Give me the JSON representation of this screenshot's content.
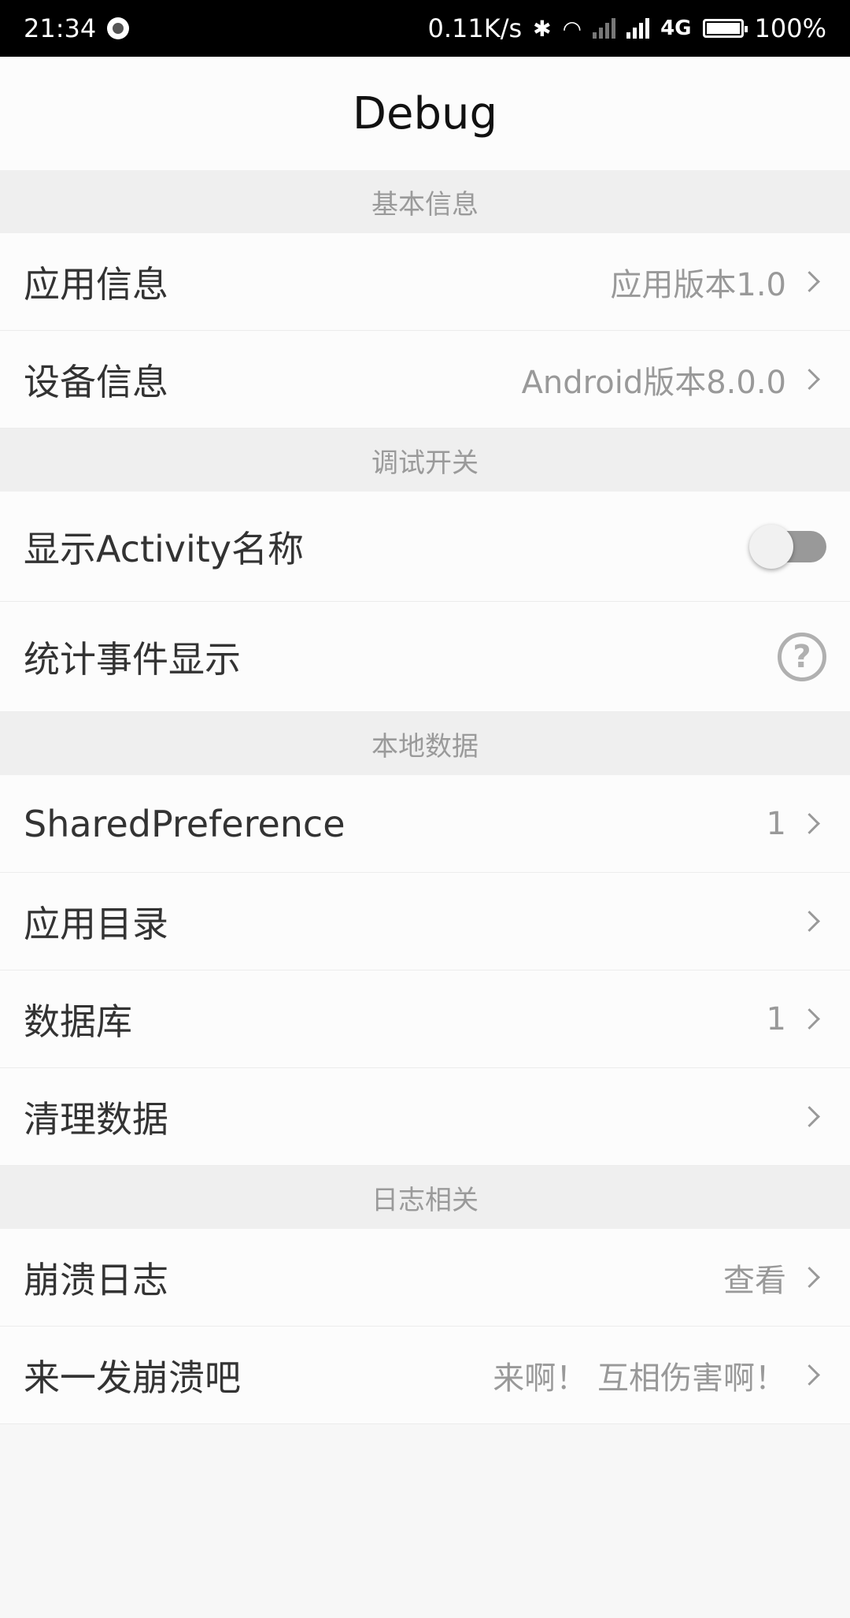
{
  "status": {
    "time": "21:34",
    "speed": "0.11K/s",
    "network": "4G",
    "battery": "100%"
  },
  "title": "Debug",
  "sections": [
    {
      "header": "基本信息",
      "items": [
        {
          "label": "应用信息",
          "value": "应用版本1.0"
        },
        {
          "label": "设备信息",
          "value": "Android版本8.0.0"
        }
      ]
    },
    {
      "header": "调试开关",
      "items": [
        {
          "label": "显示Activity名称",
          "toggle": "off"
        },
        {
          "label": "统计事件显示",
          "icon": "help-icon"
        }
      ]
    },
    {
      "header": "本地数据",
      "items": [
        {
          "label": "SharedPreference",
          "value": "1"
        },
        {
          "label": "应用目录",
          "value": ""
        },
        {
          "label": "数据库",
          "value": "1"
        },
        {
          "label": "清理数据",
          "value": ""
        }
      ]
    },
    {
      "header": "日志相关",
      "items": [
        {
          "label": "崩溃日志",
          "value": "查看"
        },
        {
          "label": "来一发崩溃吧",
          "value": "来啊！ 互相伤害啊！"
        }
      ]
    }
  ]
}
